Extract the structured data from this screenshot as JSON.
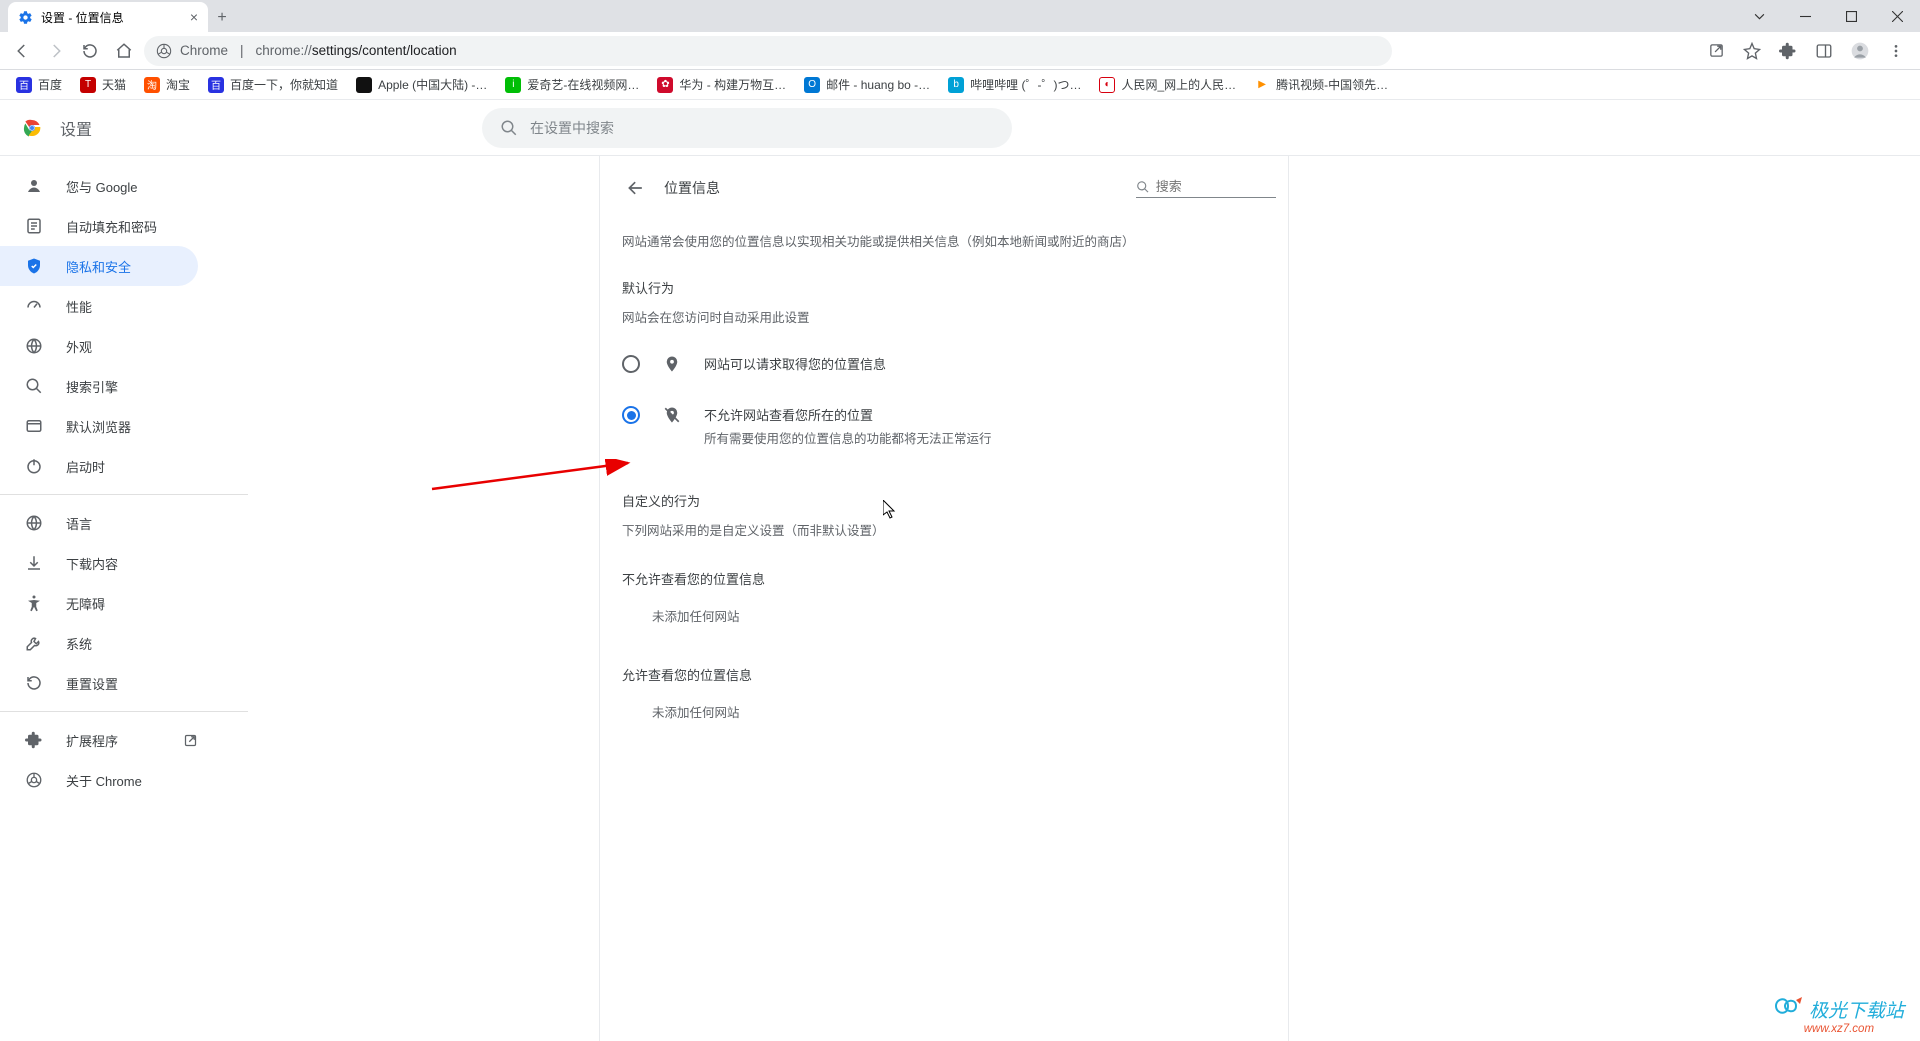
{
  "window": {
    "tab_title": "设置 - 位置信息"
  },
  "toolbar": {
    "url_host": "Chrome",
    "url_prefix": "chrome://",
    "url_path": "settings/content/location"
  },
  "bookmarks": [
    {
      "label": "百度",
      "bg": "#2932e1"
    },
    {
      "label": "天猫",
      "bg": "#c40000"
    },
    {
      "label": "淘宝",
      "bg": "#ff5000"
    },
    {
      "label": "百度一下，你就知道",
      "bg": "#2932e1"
    },
    {
      "label": "Apple (中国大陆) -…",
      "bg": "#111",
      "icon": ""
    },
    {
      "label": "爱奇艺-在线视频网…",
      "bg": "#00be06"
    },
    {
      "label": "华为 - 构建万物互…",
      "bg": "#cf0a2c",
      "icon": "✿"
    },
    {
      "label": "邮件 - huang bo -…",
      "bg": "#0078d4"
    },
    {
      "label": "哔哩哔哩 (゜-゜)つ…",
      "bg": "#00a1d6"
    },
    {
      "label": "人民网_网上的人民…",
      "bg": "#d7000f",
      "icon": "◐"
    },
    {
      "label": "腾讯视频-中国领先…",
      "bg": "#ff9000",
      "icon": "▶"
    }
  ],
  "settings": {
    "title": "设置",
    "search_placeholder": "在设置中搜索"
  },
  "sidebar": {
    "items": [
      {
        "label": "您与 Google"
      },
      {
        "label": "自动填充和密码"
      },
      {
        "label": "隐私和安全"
      },
      {
        "label": "性能"
      },
      {
        "label": "外观"
      },
      {
        "label": "搜索引擎"
      },
      {
        "label": "默认浏览器"
      },
      {
        "label": "启动时"
      }
    ],
    "lower": [
      {
        "label": "语言"
      },
      {
        "label": "下载内容"
      },
      {
        "label": "无障碍"
      },
      {
        "label": "系统"
      },
      {
        "label": "重置设置"
      }
    ],
    "bottom": [
      {
        "label": "扩展程序"
      },
      {
        "label": "关于 Chrome"
      }
    ]
  },
  "panel": {
    "title": "位置信息",
    "search_placeholder": "搜索",
    "description": "网站通常会使用您的位置信息以实现相关功能或提供相关信息（例如本地新闻或附近的商店）",
    "default_behavior_title": "默认行为",
    "default_behavior_sub": "网站会在您访问时自动采用此设置",
    "option_allow": "网站可以请求取得您的位置信息",
    "option_block": "不允许网站查看您所在的位置",
    "option_block_sub": "所有需要使用您的位置信息的功能都将无法正常运行",
    "custom_title": "自定义的行为",
    "custom_sub": "下列网站采用的是自定义设置（而非默认设置）",
    "blocked_title": "不允许查看您的位置信息",
    "blocked_empty": "未添加任何网站",
    "allowed_title": "允许查看您的位置信息",
    "allowed_empty": "未添加任何网站"
  },
  "watermark": {
    "title": "极光下载站",
    "url": "www.xz7.com"
  }
}
